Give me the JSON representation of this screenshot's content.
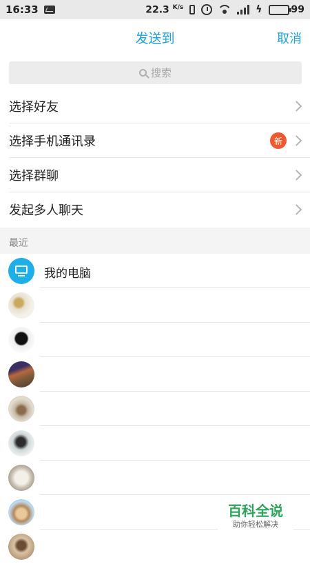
{
  "status_bar": {
    "time": "16:33",
    "speed": "22.3",
    "speed_unit": "K/s",
    "battery": "99",
    "battery_level": 0.99,
    "battery_color": "#3bc43b",
    "icons": [
      "message-icon",
      "vibrate-icon",
      "alarm-icon",
      "wifi-icon",
      "signal-icon",
      "charging-icon",
      "battery-icon"
    ]
  },
  "header": {
    "title": "发送到",
    "cancel_label": "取消",
    "accent_color": "#1aa3e0"
  },
  "search": {
    "placeholder": "搜索"
  },
  "menu": {
    "items": [
      {
        "label": "选择好友"
      },
      {
        "label": "选择手机通讯录",
        "badge": "新"
      },
      {
        "label": "选择群聊"
      },
      {
        "label": "发起多人聊天"
      }
    ]
  },
  "recent": {
    "section_label": "最近",
    "contacts": [
      {
        "name": "我的电脑",
        "avatar": "computer-icon"
      },
      {
        "name": "",
        "avatar": "photo-avatar"
      },
      {
        "name": "",
        "avatar": "photo-avatar"
      },
      {
        "name": "",
        "avatar": "photo-avatar"
      },
      {
        "name": "",
        "avatar": "photo-avatar"
      },
      {
        "name": "",
        "avatar": "photo-avatar"
      },
      {
        "name": "",
        "avatar": "photo-avatar"
      },
      {
        "name": "",
        "avatar": "photo-avatar"
      },
      {
        "name": "",
        "avatar": "photo-avatar"
      }
    ]
  },
  "watermark": {
    "title": "百科全说",
    "subtitle": "助你轻松解决"
  }
}
